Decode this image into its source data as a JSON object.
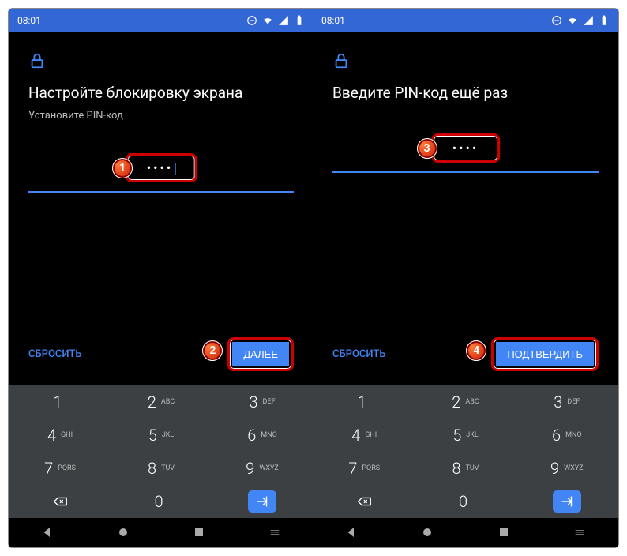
{
  "left": {
    "statusbar": {
      "time": "08:01"
    },
    "title": "Настройте блокировку экрана",
    "subtitle": "Установите PIN-код",
    "pin_dots": "••••",
    "reset": "СБРОСИТЬ",
    "primary": "ДАЛЕЕ",
    "badge_input": "1",
    "badge_button": "2"
  },
  "right": {
    "statusbar": {
      "time": "08:01"
    },
    "title": "Введите PIN-код ещё раз",
    "subtitle": "",
    "pin_dots": "••••",
    "reset": "СБРОСИТЬ",
    "primary": "ПОДТВЕРДИТЬ",
    "badge_input": "3",
    "badge_button": "4"
  },
  "keypad": [
    {
      "num": "1",
      "letters": ""
    },
    {
      "num": "2",
      "letters": "ABC"
    },
    {
      "num": "3",
      "letters": "DEF"
    },
    {
      "num": "4",
      "letters": "GHI"
    },
    {
      "num": "5",
      "letters": "JKL"
    },
    {
      "num": "6",
      "letters": "MNO"
    },
    {
      "num": "7",
      "letters": "PQRS"
    },
    {
      "num": "8",
      "letters": "TUV"
    },
    {
      "num": "9",
      "letters": "WXYZ"
    },
    {
      "num": "",
      "letters": "",
      "type": "backspace"
    },
    {
      "num": "0",
      "letters": ""
    },
    {
      "num": "",
      "letters": "",
      "type": "enter"
    }
  ]
}
